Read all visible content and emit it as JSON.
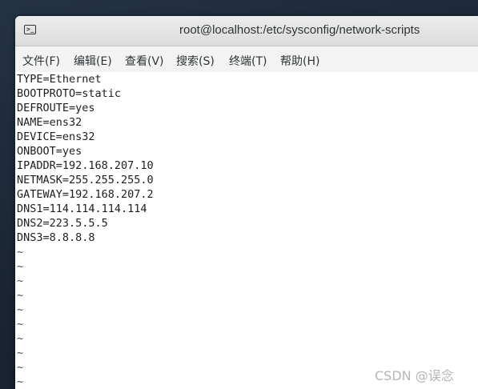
{
  "window": {
    "title": "root@localhost:/etc/sysconfig/network-scripts",
    "icon": "terminal-icon"
  },
  "menu": [
    "文件(F)",
    "编辑(E)",
    "查看(V)",
    "搜索(S)",
    "终端(T)",
    "帮助(H)"
  ],
  "terminal": {
    "lines": [
      "TYPE=Ethernet",
      "BOOTPROTO=static",
      "DEFROUTE=yes",
      "NAME=ens32",
      "DEVICE=ens32",
      "ONBOOT=yes",
      "IPADDR=192.168.207.10",
      "NETMASK=255.255.255.0",
      "GATEWAY=192.168.207.2",
      "DNS1=114.114.114.114",
      "DNS2=223.5.5.5",
      "DNS3=8.8.8.8"
    ],
    "empty_line_marker": "~"
  },
  "watermark": "CSDN @误念",
  "colors": {
    "terminal_bg": "#ffffff",
    "terminal_text": "#1e1e1e",
    "titlebar_bg": "#e4e4e4",
    "menubar_bg": "#f3f3f3",
    "desktop_bg": "#1d2633"
  }
}
